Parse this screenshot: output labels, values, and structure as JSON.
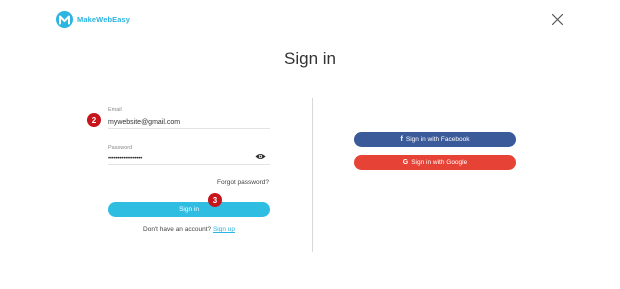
{
  "brand": {
    "name": "MakeWebEasy"
  },
  "page": {
    "title": "Sign in"
  },
  "form": {
    "email_label": "Email",
    "email_value": "mywebsite@gmail.com",
    "password_label": "Password",
    "password_value": "••••••••••••••••••",
    "forgot_label": "Forgot password?",
    "submit_label": "Sign in",
    "signup_prompt": "Don't have an account?",
    "signup_link": "Sign up"
  },
  "social": {
    "facebook_icon_glyph": "f",
    "facebook_label": "Sign in with Facebook",
    "google_icon_glyph": "G",
    "google_label": "Sign in with Google"
  },
  "annotations": {
    "step_2": "2",
    "step_3": "3"
  },
  "colors": {
    "brand": "#2bb5e0",
    "signin_button": "#2fbde2",
    "facebook": "#3b5a99",
    "google": "#e64236",
    "badge": "#c8141b"
  },
  "icons": {
    "logo": "makewebeasy-logo-icon",
    "close": "close-icon",
    "password_toggle": "eye-icon"
  }
}
